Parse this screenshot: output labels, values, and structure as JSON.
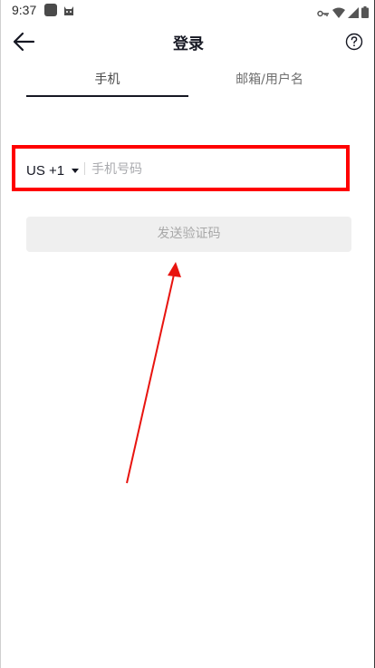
{
  "status_bar": {
    "time": "9:37"
  },
  "header": {
    "title": "登录"
  },
  "tabs": [
    {
      "label": "手机",
      "active": true
    },
    {
      "label": "邮箱/用户名",
      "active": false
    }
  ],
  "phone_form": {
    "country_code": "US +1",
    "phone_placeholder": "手机号码",
    "phone_value": ""
  },
  "send_code_button": {
    "label": "发送验证码",
    "enabled": false
  },
  "colors": {
    "highlight_box": "#ff0000",
    "arrow": "#e8140f",
    "button_bg": "#efefef",
    "button_text": "#a8a8a8"
  }
}
